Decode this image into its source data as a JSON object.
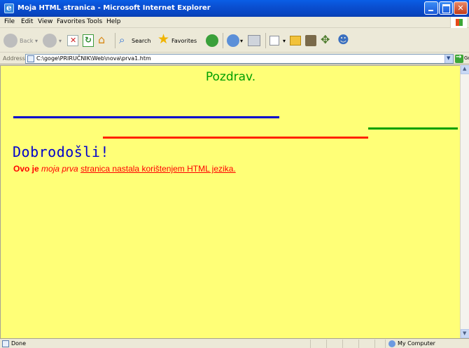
{
  "window": {
    "title": "Moja HTML stranica - Microsoft Internet Explorer"
  },
  "menu": {
    "items": [
      "File",
      "Edit",
      "View",
      "Favorites",
      "Tools",
      "Help"
    ]
  },
  "toolbar": {
    "back_label": "Back",
    "search_label": "Search",
    "favorites_label": "Favorites"
  },
  "address": {
    "label": "Address",
    "url": "C:\\goge\\PRIRUČNIK\\Web\\nova\\prva1.htm",
    "go_label": "Go"
  },
  "page": {
    "heading": "Pozdrav.",
    "welcome": "Dobrodošli!",
    "sentence_bold": "Ovo je",
    "sentence_italic": "moja prva",
    "sentence_underline": "stranica nastala korištenjem HTML jezika.",
    "background_color": "#ffff77",
    "heading_color": "#00a000",
    "welcome_color": "#0000cc",
    "sentence_color": "#ff0000"
  },
  "status": {
    "text": "Done",
    "zone": "My Computer"
  }
}
